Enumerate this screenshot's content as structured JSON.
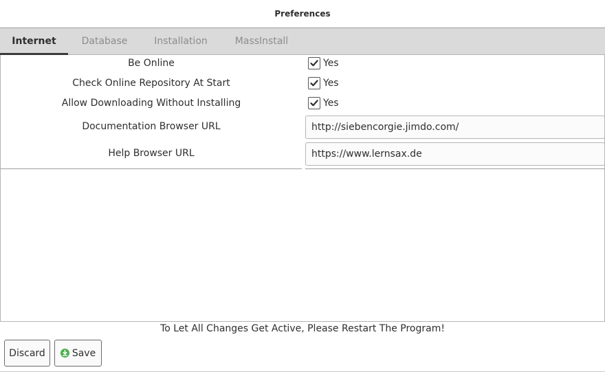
{
  "window": {
    "title": "Preferences"
  },
  "tabs": [
    {
      "label": "Internet",
      "active": true
    },
    {
      "label": "Database",
      "active": false
    },
    {
      "label": "Installation",
      "active": false
    },
    {
      "label": "MassInstall",
      "active": false
    }
  ],
  "internet": {
    "be_online": {
      "label": "Be Online",
      "checked": true,
      "value_label": "Yes"
    },
    "check_repo": {
      "label": "Check Online Repository At Start",
      "checked": true,
      "value_label": "Yes"
    },
    "allow_download": {
      "label": "Allow Downloading Without Installing",
      "checked": true,
      "value_label": "Yes"
    },
    "doc_url": {
      "label": "Documentation Browser URL",
      "value": "http://siebencorgie.jimdo.com/"
    },
    "help_url": {
      "label": "Help Browser URL",
      "value": "https://www.lernsax.de"
    }
  },
  "notice": "To Let All Changes Get Active, Please Restart The Program!",
  "buttons": {
    "discard": "Discard",
    "save": "Save"
  },
  "colors": {
    "save_icon": "#4caf50",
    "active_tab_underline": "#3a3a3a"
  }
}
